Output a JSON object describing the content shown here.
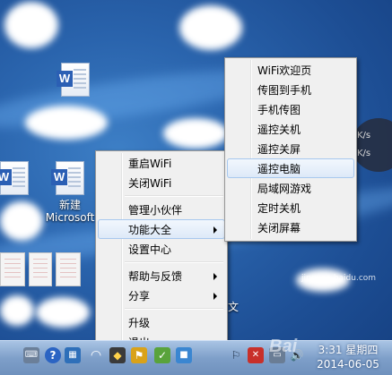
{
  "desktop": {
    "icons": [
      {
        "label": "新建",
        "sublabel": "Microsoft",
        "glyph": "W"
      },
      {
        "label": "",
        "glyph": "W"
      },
      {
        "label": "",
        "glyph": "W"
      }
    ],
    "side_labels": [
      "文"
    ],
    "partial_text": "K/s"
  },
  "main_menu": {
    "items": [
      {
        "label": "重启WiFi"
      },
      {
        "label": "关闭WiFi"
      },
      {
        "label": "管理小伙伴"
      },
      {
        "label": "功能大全",
        "has_submenu": true,
        "highlighted": true
      },
      {
        "label": "设置中心"
      },
      {
        "label": "帮助与反馈",
        "has_submenu": true
      },
      {
        "label": "分享",
        "has_submenu": true
      },
      {
        "label": "升级"
      },
      {
        "label": "退出"
      }
    ]
  },
  "sub_menu": {
    "items": [
      {
        "label": "WiFi欢迎页"
      },
      {
        "label": "传图到手机"
      },
      {
        "label": "手机传图"
      },
      {
        "label": "遥控关机"
      },
      {
        "label": "遥控关屏"
      },
      {
        "label": "遥控电脑",
        "highlighted": true
      },
      {
        "label": "局域网游戏"
      },
      {
        "label": "定时关机"
      },
      {
        "label": "关闭屏幕"
      }
    ]
  },
  "taskbar": {
    "tray_icons": [
      "keyboard-icon",
      "help-icon",
      "network-icon",
      "wifi-icon",
      "security-icon",
      "flag-icon",
      "volume-icon"
    ],
    "clock": {
      "time": "3:31",
      "weekday": "星期四",
      "date": "2014-06-05"
    }
  },
  "watermark": {
    "text": "Bai",
    "url": "jingyan.baidu.com"
  }
}
